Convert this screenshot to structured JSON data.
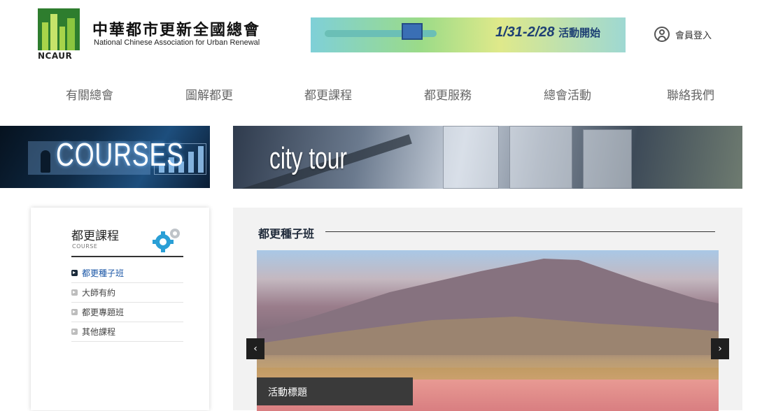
{
  "header": {
    "logo_abbr": "NCAUR",
    "logo_zh": "中華都市更新全國總會",
    "logo_en": "National Chinese Association for Urban Renewal",
    "banner_text": "1/31-2/28",
    "banner_text2": "活動開始",
    "login_label": "會員登入"
  },
  "nav": {
    "items": [
      {
        "label": "有關總會"
      },
      {
        "label": "圖解都更"
      },
      {
        "label": "都更課程"
      },
      {
        "label": "都更服務"
      },
      {
        "label": "總會活動"
      },
      {
        "label": "聯絡我們"
      }
    ]
  },
  "hero": {
    "left_title": "COURSES",
    "right_title": "city tour"
  },
  "sidebar": {
    "title": "都更課程",
    "subtitle": "COURSE",
    "items": [
      {
        "label": "都更種子班",
        "active": true
      },
      {
        "label": "大師有約",
        "active": false
      },
      {
        "label": "都更專題班",
        "active": false
      },
      {
        "label": "其他課程",
        "active": false
      }
    ]
  },
  "content": {
    "section_title": "都更種子班",
    "slide_caption": "活動標題",
    "prev_symbol": "‹",
    "next_symbol": "›"
  },
  "colors": {
    "accent_blue": "#1a56a6",
    "nav_text": "#666666",
    "caption_bg": "#3a3a3a"
  }
}
